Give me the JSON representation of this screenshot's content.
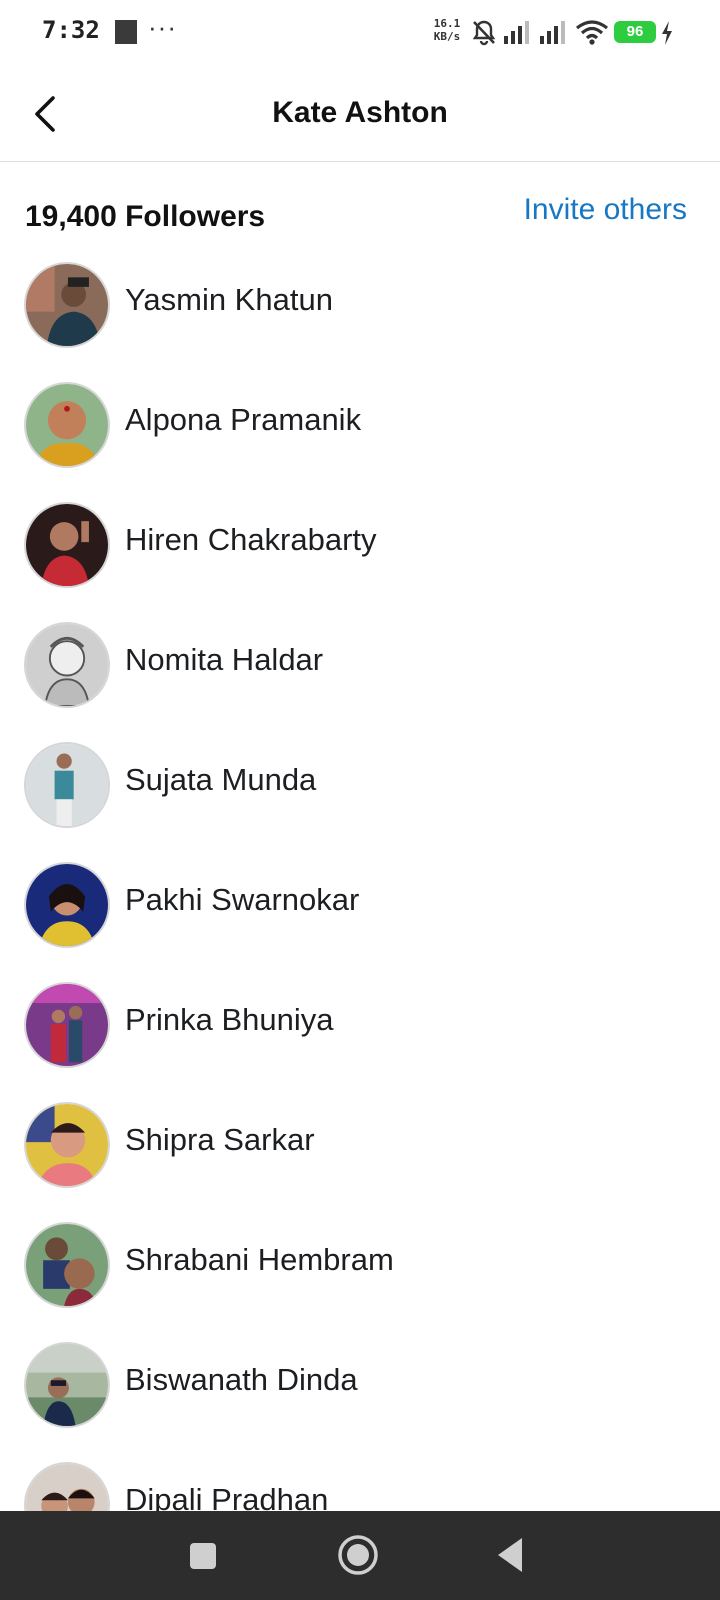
{
  "status_bar": {
    "time": "7:32",
    "dots": "···",
    "net_speed_value": "16.1",
    "net_speed_unit": "KB/s",
    "battery": "96"
  },
  "header": {
    "title": "Kate Ashton"
  },
  "summary": {
    "followers_label": "19,400 Followers",
    "invite_label": "Invite others"
  },
  "followers": [
    {
      "name": "Yasmin Khatun"
    },
    {
      "name": "Alpona Pramanik"
    },
    {
      "name": "Hiren Chakrabarty"
    },
    {
      "name": "Nomita Haldar"
    },
    {
      "name": "Sujata Munda"
    },
    {
      "name": "Pakhi Swarnokar"
    },
    {
      "name": "Prinka Bhuniya"
    },
    {
      "name": "Shipra Sarkar"
    },
    {
      "name": "Shrabani Hembram"
    },
    {
      "name": "Biswanath Dinda"
    },
    {
      "name": "Dipali Pradhan"
    }
  ],
  "colors": {
    "accent_link": "#1877c2",
    "battery_green": "#2ecc40",
    "nav_background": "#2d2d2d"
  },
  "icons": {
    "back": "chevron-left-icon",
    "mute": "bell-off-icon",
    "signal": "signal-bars-icon",
    "wifi": "wifi-icon",
    "charge": "lightning-icon",
    "nav_recents": "square-icon",
    "nav_home": "circle-icon",
    "nav_back": "triangle-back-icon"
  }
}
